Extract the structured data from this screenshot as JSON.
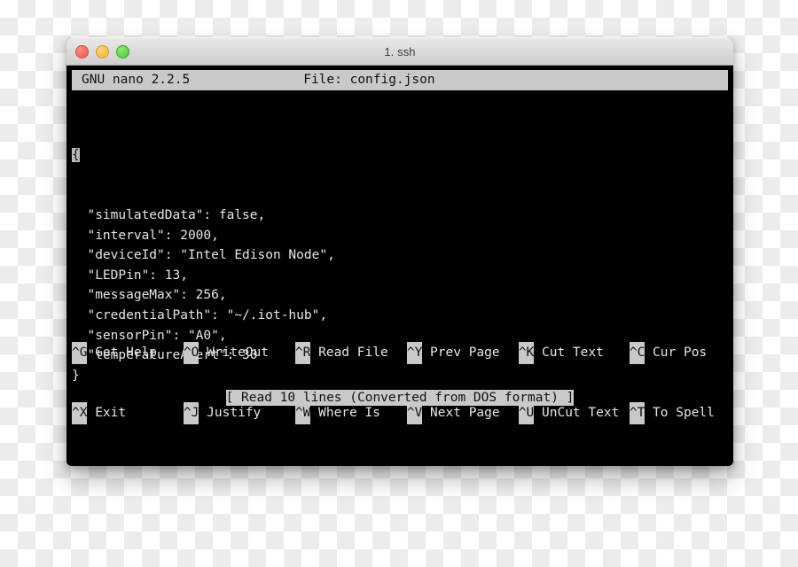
{
  "window": {
    "title": "1. ssh",
    "controls": [
      {
        "name": "close",
        "color": "#f5584c"
      },
      {
        "name": "minimize",
        "color": "#f5b32b"
      },
      {
        "name": "maximize",
        "color": "#45c630"
      }
    ]
  },
  "nano": {
    "version_label": "GNU nano 2.2.5",
    "file_label": "File: config.json",
    "cursor_char": "{",
    "lines": [
      "  \"simulatedData\": false,",
      "  \"interval\": 2000,",
      "  \"deviceId\": \"Intel Edison Node\",",
      "  \"LEDPin\": 13,",
      "  \"messageMax\": 256,",
      "  \"credentialPath\": \"~/.iot-hub\",",
      "  \"sensorPin\": \"A0\",",
      "  \"temperatureAlert\": 30",
      "}"
    ],
    "status_message": "[ Read 10 lines (Converted from DOS format) ]",
    "shortcuts_row1": [
      {
        "key": "^G",
        "label": "Get Help",
        "width_class": "w-gethelp"
      },
      {
        "key": "^O",
        "label": "WriteOut",
        "width_class": "w-writeout"
      },
      {
        "key": "^R",
        "label": "Read File",
        "width_class": "w-readfile"
      },
      {
        "key": "^Y",
        "label": "Prev Page",
        "width_class": "w-prevpage"
      },
      {
        "key": "^K",
        "label": "Cut Text",
        "width_class": "w-cuttext"
      },
      {
        "key": "^C",
        "label": "Cur Pos",
        "width_class": "w-curpos"
      }
    ],
    "shortcuts_row2": [
      {
        "key": "^X",
        "label": "Exit",
        "width_class": "w-gethelp"
      },
      {
        "key": "^J",
        "label": "Justify",
        "width_class": "w-writeout"
      },
      {
        "key": "^W",
        "label": "Where Is",
        "width_class": "w-readfile"
      },
      {
        "key": "^V",
        "label": "Next Page",
        "width_class": "w-prevpage"
      },
      {
        "key": "^U",
        "label": "UnCut Text",
        "width_class": "w-cuttext"
      },
      {
        "key": "^T",
        "label": "To Spell",
        "width_class": "w-curpos"
      }
    ]
  },
  "colors": {
    "terminal_background": "#000000",
    "terminal_foreground": "#e6e6e6",
    "inverted_background": "#c9c9c9",
    "inverted_foreground": "#111111",
    "titlebar_background": "#dcdcdc"
  }
}
